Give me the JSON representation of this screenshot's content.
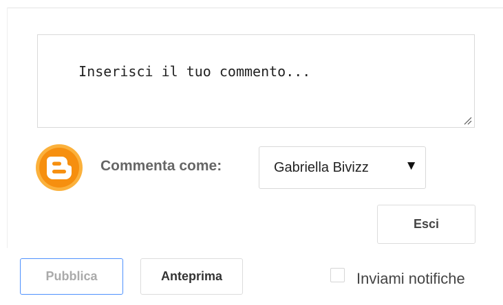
{
  "comment_form": {
    "textarea_placeholder": "Inserisci il tuo commento...",
    "comment_as_label": "Commenta come:",
    "identity": {
      "selected": "Gabriella Bivizz",
      "caret": "▼",
      "avatar_icon": "blogger-logo-icon"
    },
    "sign_out_label": "Esci",
    "publish_label": "Pubblica",
    "preview_label": "Anteprima",
    "notify_label": "Inviami notifiche",
    "notify_checked": false
  },
  "colors": {
    "blogger_orange": "#f68f0f",
    "publish_border": "#4d90fe",
    "label_gray": "#666666"
  }
}
